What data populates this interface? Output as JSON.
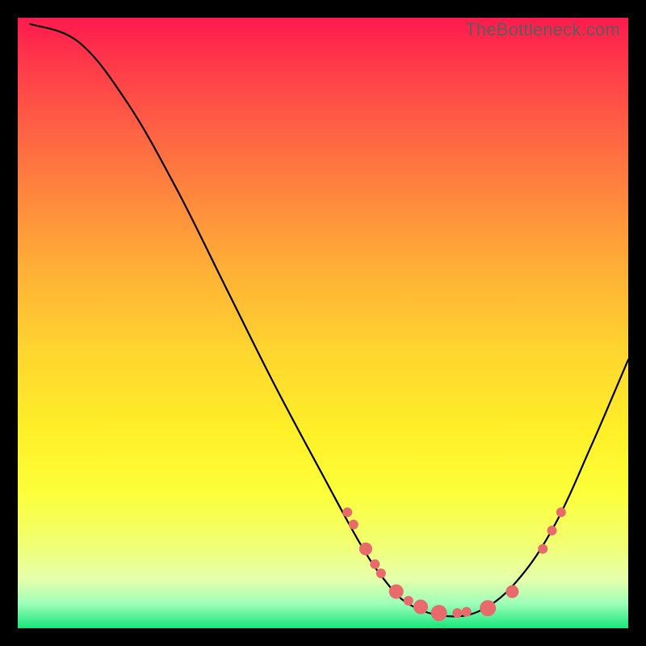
{
  "watermark_text": "TheBottleneck.com",
  "chart_data": {
    "type": "line",
    "title": "",
    "xlabel": "",
    "ylabel": "",
    "xlim": [
      0,
      100
    ],
    "ylim": [
      0,
      100
    ],
    "series": [
      {
        "name": "curve",
        "points": [
          {
            "x": 2,
            "y": 99
          },
          {
            "x": 10,
            "y": 96
          },
          {
            "x": 18,
            "y": 86
          },
          {
            "x": 26,
            "y": 72
          },
          {
            "x": 34,
            "y": 56
          },
          {
            "x": 42,
            "y": 40
          },
          {
            "x": 50,
            "y": 25
          },
          {
            "x": 56,
            "y": 14
          },
          {
            "x": 60,
            "y": 8
          },
          {
            "x": 64,
            "y": 4
          },
          {
            "x": 70,
            "y": 2
          },
          {
            "x": 76,
            "y": 3
          },
          {
            "x": 82,
            "y": 8
          },
          {
            "x": 88,
            "y": 17
          },
          {
            "x": 94,
            "y": 30
          },
          {
            "x": 100,
            "y": 44
          }
        ]
      }
    ],
    "markers": [
      {
        "x": 54,
        "y": 19,
        "r": 6
      },
      {
        "x": 55,
        "y": 17,
        "r": 6
      },
      {
        "x": 57,
        "y": 13,
        "r": 8
      },
      {
        "x": 58.5,
        "y": 10.5,
        "r": 6
      },
      {
        "x": 59.5,
        "y": 9,
        "r": 6
      },
      {
        "x": 62,
        "y": 6,
        "r": 9
      },
      {
        "x": 64,
        "y": 4.5,
        "r": 6
      },
      {
        "x": 66,
        "y": 3.5,
        "r": 9
      },
      {
        "x": 69,
        "y": 2.5,
        "r": 10
      },
      {
        "x": 72,
        "y": 2.5,
        "r": 6
      },
      {
        "x": 73.5,
        "y": 2.7,
        "r": 6
      },
      {
        "x": 77,
        "y": 3.3,
        "r": 10
      },
      {
        "x": 81,
        "y": 6,
        "r": 8
      },
      {
        "x": 86,
        "y": 13,
        "r": 6
      },
      {
        "x": 87.5,
        "y": 16,
        "r": 6
      },
      {
        "x": 89,
        "y": 19,
        "r": 6
      }
    ]
  }
}
